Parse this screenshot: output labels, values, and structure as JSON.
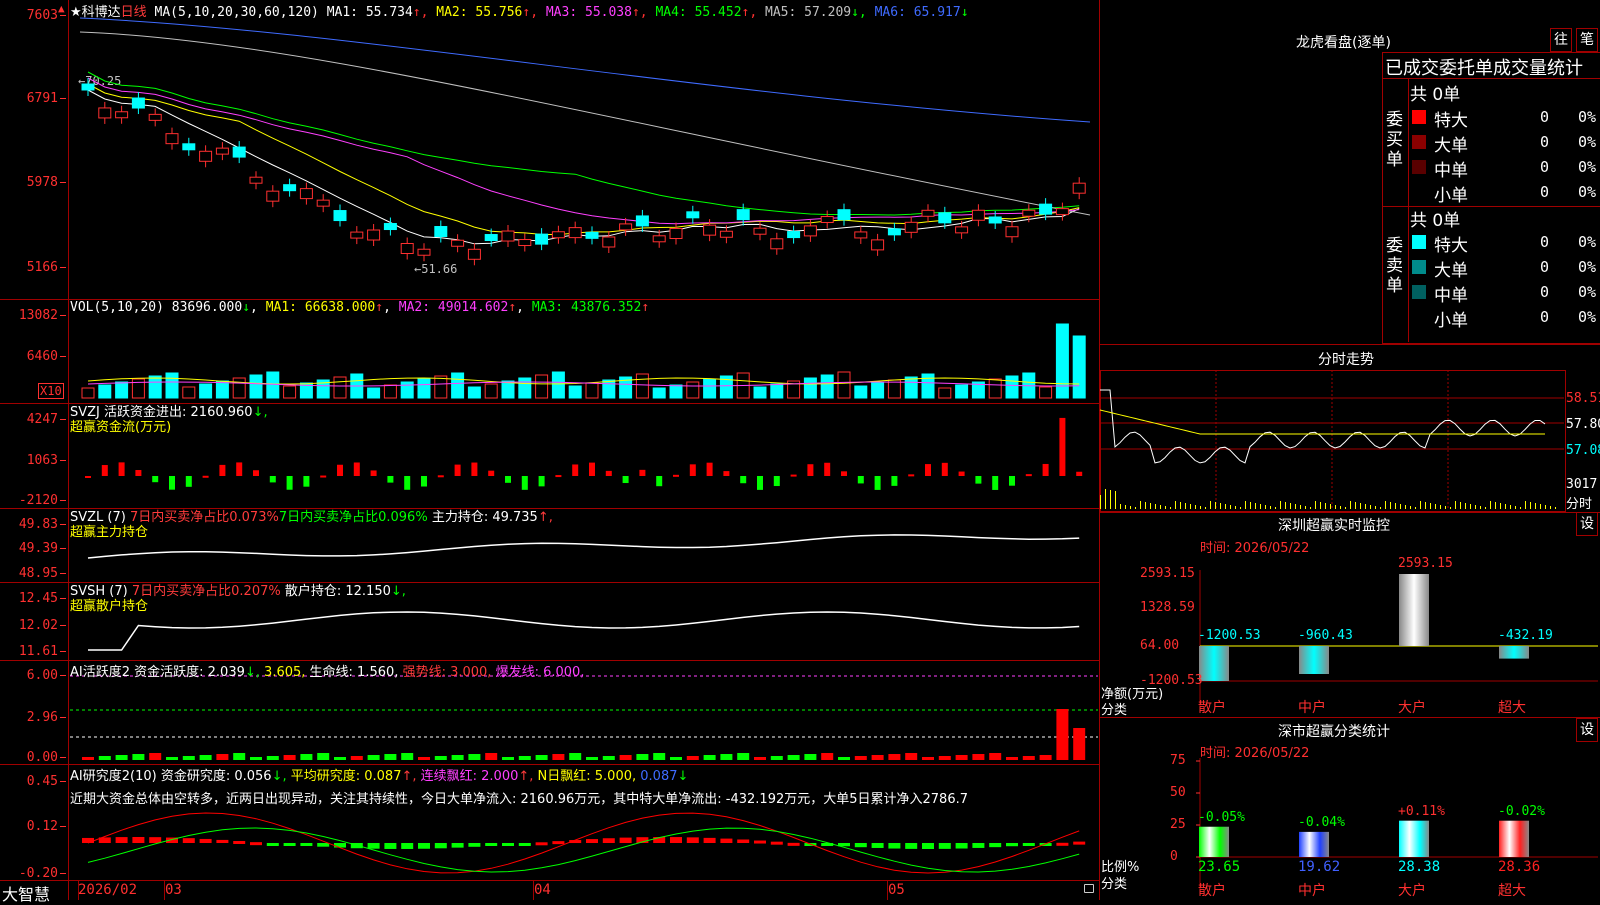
{
  "header": {
    "stock_name": "★科博达",
    "period": "日线",
    "ma_label": "MA(5,10,20,30,60,120)",
    "ma_values": [
      {
        "name": "MA1:",
        "value": "55.734",
        "arrow": "↑",
        "color": "#ffffff"
      },
      {
        "name": "MA2:",
        "value": "55.756",
        "arrow": "↑",
        "color": "#ffff00"
      },
      {
        "name": "MA3:",
        "value": "55.038",
        "arrow": "↑",
        "color": "#ff40ff"
      },
      {
        "name": "MA4:",
        "value": "55.452",
        "arrow": "↑",
        "color": "#00ff00"
      },
      {
        "name": "MA5:",
        "value": "57.209",
        "arrow": "↓",
        "color": "#c0c0c0"
      },
      {
        "name": "MA6:",
        "value": "65.917",
        "arrow": "↓",
        "color": "#3f6bff"
      }
    ]
  },
  "price_axis": [
    "7603",
    "6791",
    "5978",
    "5166"
  ],
  "price_annotations": {
    "high": "70.25",
    "low": "51.66"
  },
  "vol": {
    "label": "VOL(5,10,20)",
    "value": "83696.000",
    "value_arrow": "↓",
    "ma1": "MA1: 66638.000",
    "ma1_arrow": "↑",
    "ma2": "MA2: 49014.602",
    "ma2_arrow": "↑",
    "ma3": "MA3: 43876.352",
    "ma3_arrow": "↑",
    "axis": [
      "13082",
      "6460"
    ],
    "unit": "X10"
  },
  "svzj": {
    "line1": "SVZJ  活跃资金进出: 2160.960",
    "line1_arrow": "↓,",
    "line2": "超赢资金流(万元)",
    "axis": [
      "4247",
      "1063",
      "-2120"
    ]
  },
  "svzl": {
    "name": "SVZL (7)",
    "p1": "7日内买卖净占比0.073%",
    "p2": "7日内买卖净占比0.096%",
    "p3": "主力持仓: 49.735",
    "p3_arrow": "↑,",
    "line2": "超赢主力持仓",
    "axis": [
      "49.83",
      "49.39",
      "48.95"
    ]
  },
  "svsh": {
    "name": "SVSH (7)",
    "p1": "7日内买卖净占比0.207%",
    "p2": "散户持仓: 12.150",
    "p2_arrow": "↓,",
    "line2": "超赢散户持仓",
    "axis": [
      "12.45",
      "12.02",
      "11.61"
    ]
  },
  "ai1": {
    "name": "AI活跃度2",
    "p1": "资金活跃度: 2.039",
    "p1_arrow": "↓,",
    "p2": "3.605,",
    "p3": "生命线: 1.560,",
    "p4": "强势线: 3.000,",
    "p5": "爆发线: 6.000,",
    "axis": [
      "6.00",
      "2.96",
      "0.00"
    ]
  },
  "ai2": {
    "name": "AI研究度2(10)",
    "p1": "资金研究度: 0.056",
    "p1_arrow": "↓,",
    "p2": "平均研究度: 0.087",
    "p2_arrow": "↑,",
    "p3": "连续飘红: 2.000",
    "p3_arrow": "↑,",
    "p4": "N日飘红: 5.000,",
    "p5": "0.087",
    "p5_arrow": "↓",
    "comment": "近期大资金总体由空转多，近两日出现异动，关注其持续性，今日大单净流入: 2160.96万元，其中特大单净流出: -432.192万元，大单5日累计净入2786.7",
    "axis": [
      "0.45",
      "0.12",
      "-0.20"
    ]
  },
  "date_axis": {
    "brand": "大智慧",
    "labels": [
      "2026/02",
      "03",
      "04",
      "05"
    ]
  },
  "right": {
    "lhb_title": "龙虎看盘(逐单)",
    "btn_wang": "往",
    "btn_bi": "笔",
    "stats_title": "已成交委托单成交量统计",
    "buy_side": "委买单",
    "sell_side": "委卖单",
    "buy_total": "共 0单",
    "sell_total": "共 0单",
    "buy_rows": [
      {
        "label": "特大",
        "count": "0",
        "pct": "0%",
        "color": "#ff0000"
      },
      {
        "label": "大单",
        "count": "0",
        "pct": "0%",
        "color": "#8b0000"
      },
      {
        "label": "中单",
        "count": "0",
        "pct": "0%",
        "color": "#5a0000"
      },
      {
        "label": "小单",
        "count": "0",
        "pct": "0%",
        "color": "#000000"
      }
    ],
    "sell_rows": [
      {
        "label": "特大",
        "count": "0",
        "pct": "0%",
        "color": "#00ffff"
      },
      {
        "label": "大单",
        "count": "0",
        "pct": "0%",
        "color": "#008b8b"
      },
      {
        "label": "中单",
        "count": "0",
        "pct": "0%",
        "color": "#006060"
      },
      {
        "label": "小单",
        "count": "0",
        "pct": "0%",
        "color": "#000000"
      }
    ],
    "intraday_title": "分时走势",
    "intraday_axis": [
      "58.51",
      "57.80",
      "57.08",
      "3017"
    ],
    "intraday_unit": "分时",
    "monitor_title": "深圳超赢实时监控",
    "monitor_btn": "设",
    "monitor_time": "时间: 2026/05/22",
    "monitor_axis": [
      "2593.15",
      "1328.59",
      "64.00",
      "-1200.53"
    ],
    "monitor_ylabel": "净额(万元)",
    "monitor_xlabel": "分类",
    "classify_title": "深市超赢分类统计",
    "classify_btn": "设",
    "classify_time": "时间: 2026/05/22",
    "classify_axis": [
      "75",
      "50",
      "25",
      "0"
    ],
    "classify_ylabel": "比例%",
    "classify_xlabel": "分类"
  },
  "chart_data": [
    {
      "type": "bar",
      "title": "深圳超赢实时监控",
      "categories": [
        "散户",
        "中户",
        "大户",
        "超大"
      ],
      "values": [
        -1200.53,
        -960.43,
        2593.15,
        -432.19
      ],
      "labels": [
        "-1200.53",
        "-960.43",
        "2593.15",
        "-432.19"
      ],
      "ylim": [
        -1200.53,
        2593.15
      ],
      "ylabel": "净额(万元)",
      "xlabel": "分类"
    },
    {
      "type": "bar",
      "title": "深市超赢分类统计",
      "categories": [
        "散户",
        "中户",
        "大户",
        "超大"
      ],
      "values": [
        23.65,
        19.62,
        28.38,
        28.36
      ],
      "changes": [
        "-0.05%",
        "-0.04%",
        "+0.11%",
        "-0.02%"
      ],
      "labels": [
        "23.65",
        "19.62",
        "28.38",
        "28.36"
      ],
      "ylim": [
        0,
        75
      ],
      "ylabel": "比例%",
      "xlabel": "分类"
    }
  ]
}
